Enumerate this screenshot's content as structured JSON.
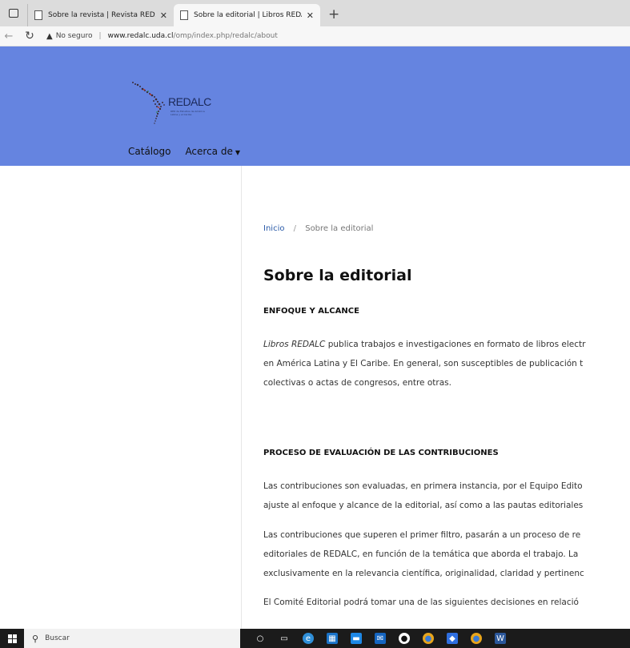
{
  "browser": {
    "tabs": [
      {
        "title": "Sobre la revista | Revista REDALC",
        "active": false
      },
      {
        "title": "Sobre la editorial | Libros REDALC",
        "active": true
      }
    ],
    "new_tab": "+",
    "address": {
      "warning": "No seguro",
      "host": "www.redalc.uda.cl",
      "path": "/omp/index.php/redalc/about"
    }
  },
  "site": {
    "logo_text": "REDALC",
    "logo_subtitle": "RED de Estudios de América Latina y el Caribe",
    "nav": [
      {
        "label": "Catálogo"
      },
      {
        "label": "Acerca de"
      }
    ]
  },
  "breadcrumb": {
    "home": "Inicio",
    "separator": "/",
    "current": "Sobre la editorial"
  },
  "page": {
    "title": "Sobre la editorial",
    "sections": [
      {
        "heading": "ENFOQUE Y ALCANCE",
        "lines": [
          {
            "italic": "Libros REDALC",
            "text": " publica trabajos e investigaciones en formato de libros electr"
          },
          {
            "text": "en América Latina y El Caribe. En general, son susceptibles de publicación t"
          },
          {
            "text": "colectivas o actas de congresos, entre otras."
          }
        ]
      },
      {
        "heading": "PROCESO DE EVALUACIÓN DE LAS CONTRIBUCIONES",
        "para1": [
          "Las contribuciones son evaluadas, en primera instancia, por el Equipo Edito",
          "ajuste al enfoque y alcance de la editorial, así como a las pautas editoriales"
        ],
        "para2": [
          "Las contribuciones que superen el primer filtro, pasarán a un proceso de re",
          "editoriales de REDALC, en función de la temática que aborda el trabajo. La",
          "exclusivamente en la relevancia científica, originalidad, claridad y pertinenc"
        ],
        "para3": [
          "El Comité Editorial podrá tomar una de las siguientes decisiones en relació"
        ]
      }
    ]
  },
  "taskbar": {
    "search_placeholder": "Buscar",
    "apps": [
      {
        "name": "cortana-icon",
        "color": "#1b1b1b"
      },
      {
        "name": "task-view-icon",
        "color": "#1b1b1b"
      },
      {
        "name": "edge-icon",
        "color": "#2f8fd8"
      },
      {
        "name": "store-icon",
        "color": "#1a73c8"
      },
      {
        "name": "file-explorer-icon",
        "color": "#1e88e5"
      },
      {
        "name": "mail-icon",
        "color": "#1565c0"
      },
      {
        "name": "github-icon",
        "color": "#1b1b1b"
      },
      {
        "name": "chrome-icon",
        "color": "#e8a51c"
      },
      {
        "name": "dropbox-icon",
        "color": "#2f6fe0"
      },
      {
        "name": "chrome-alt-icon",
        "color": "#e8a51c"
      },
      {
        "name": "word-icon",
        "color": "#2b579a"
      }
    ]
  }
}
